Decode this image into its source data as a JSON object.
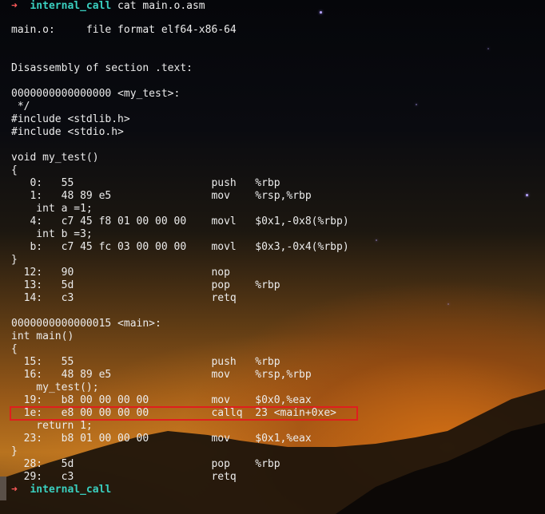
{
  "terminal": {
    "prompt_arrow": "➜",
    "prompt_dir": "internal_call",
    "command": " cat main.o.asm",
    "lines": [
      "",
      "main.o:     file format elf64-x86-64",
      "",
      "",
      "Disassembly of section .text:",
      "",
      "0000000000000000 <my_test>:",
      " */",
      "#include <stdlib.h>",
      "#include <stdio.h>",
      "",
      "void my_test()",
      "{",
      "   0:   55                      push   %rbp",
      "   1:   48 89 e5                mov    %rsp,%rbp",
      "    int a =1;",
      "   4:   c7 45 f8 01 00 00 00    movl   $0x1,-0x8(%rbp)",
      "    int b =3;",
      "   b:   c7 45 fc 03 00 00 00    movl   $0x3,-0x4(%rbp)",
      "}",
      "  12:   90                      nop",
      "  13:   5d                      pop    %rbp",
      "  14:   c3                      retq",
      "",
      "0000000000000015 <main>:",
      "int main()",
      "{",
      "  15:   55                      push   %rbp",
      "  16:   48 89 e5                mov    %rsp,%rbp",
      "    my_test();",
      "  19:   b8 00 00 00 00          mov    $0x0,%eax",
      "  1e:   e8 00 00 00 00          callq  23 <main+0xe>",
      "    return 1;",
      "  23:   b8 01 00 00 00          mov    $0x1,%eax",
      "}",
      "  28:   5d                      pop    %rbp",
      "  29:   c3                      retq"
    ],
    "final_prompt_arrow": "➜",
    "final_prompt_dir": "internal_call"
  },
  "colors": {
    "prompt_arrow": "#ff5a5a",
    "prompt_dir": "#3ad0c0",
    "highlight_box": "#e01e1e",
    "text": "#ececec"
  }
}
